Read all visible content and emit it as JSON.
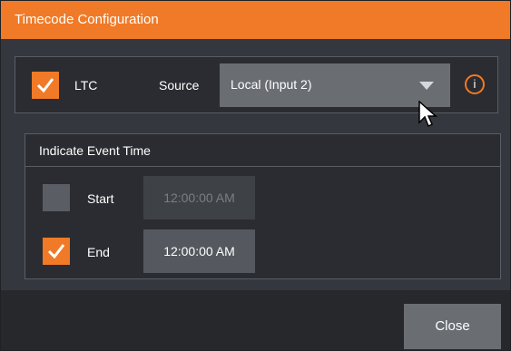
{
  "dialog": {
    "title": "Timecode Configuration"
  },
  "ltc": {
    "checkbox_checked": true,
    "label": "LTC",
    "source_label": "Source",
    "source_value": "Local (Input 2)",
    "info_glyph": "i"
  },
  "event_time": {
    "header": "Indicate Event Time",
    "start": {
      "checked": false,
      "label": "Start",
      "time": "12:00:00 AM"
    },
    "end": {
      "checked": true,
      "label": "End",
      "time": "12:00:00 AM"
    }
  },
  "footer": {
    "close_label": "Close"
  },
  "colors": {
    "accent": "#f07a27",
    "panel": "#2a2c31",
    "background": "#34373d"
  },
  "icons": {
    "check": "checkmark-icon",
    "dropdown": "chevron-down-icon",
    "info": "info-icon",
    "cursor": "mouse-pointer-icon"
  }
}
